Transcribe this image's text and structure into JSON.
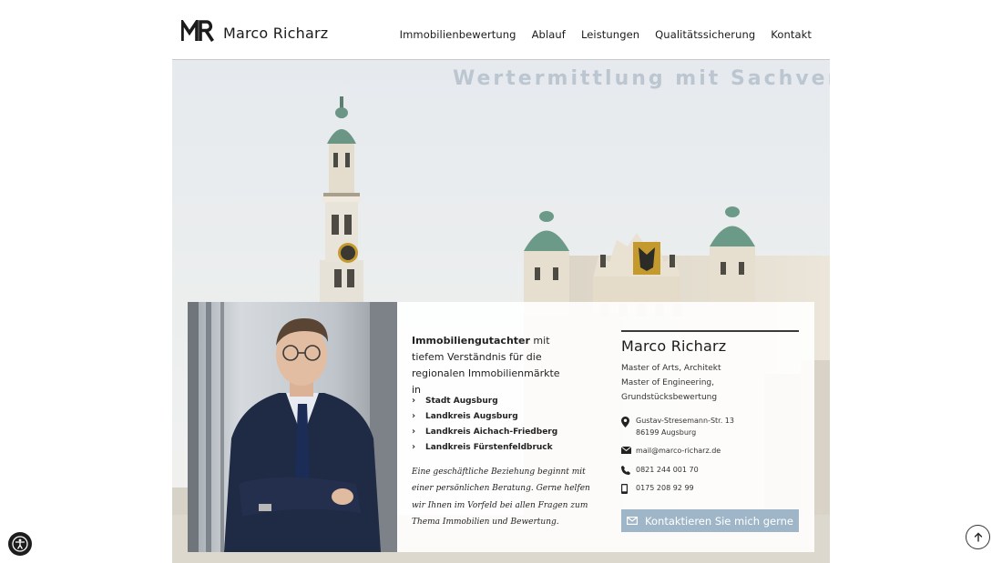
{
  "brand": {
    "name": "Marco Richarz",
    "logo_mark": "MR"
  },
  "nav": {
    "items": [
      {
        "label": "Immobilienbewertung"
      },
      {
        "label": "Ablauf"
      },
      {
        "label": "Leistungen"
      },
      {
        "label": "Qualitätssicherung"
      },
      {
        "label": "Kontakt"
      }
    ]
  },
  "hero": {
    "title": "Wertermittlung mit Sachverstand"
  },
  "intro": {
    "strong": "Immobiliengutachter",
    "text": " mit tiefem Verständnis für die regionalen Immobilienmärkte in"
  },
  "regions": [
    {
      "label": "Stadt Augsburg"
    },
    {
      "label": "Landkreis Augsburg"
    },
    {
      "label": "Landkreis Aichach-Friedberg"
    },
    {
      "label": "Landkreis Fürstenfeldbruck"
    }
  ],
  "quote": "Eine geschäftliche Beziehung beginnt mit einer persönlichen Beratung. Gerne helfen wir Ihnen im Vorfeld bei allen Fragen zum Thema Immobilien und Bewertung.",
  "contact": {
    "name": "Marco Richarz",
    "title_1": "Master of Arts, Architekt",
    "title_2": "Master of Engineering,",
    "title_3": "Grundstücksbewertung",
    "street": "Gustav-Stresemann-Str. 13",
    "city": "86199 Augsburg",
    "email": "mail@marco-richarz.de",
    "phone": "0821 244 001 70",
    "mobile": "0175 208 92 99",
    "cta_label": "Kontaktieren Sie mich gerne"
  },
  "colors": {
    "accent": "#9fb6c9",
    "text": "#1b1b1b",
    "rule": "#3a3a3a"
  },
  "icons": {
    "location": "map-pin-icon",
    "email": "envelope-icon",
    "phone": "phone-icon",
    "mobile": "mobile-icon",
    "accessibility": "accessibility-icon",
    "back_to_top": "arrow-up-icon"
  }
}
